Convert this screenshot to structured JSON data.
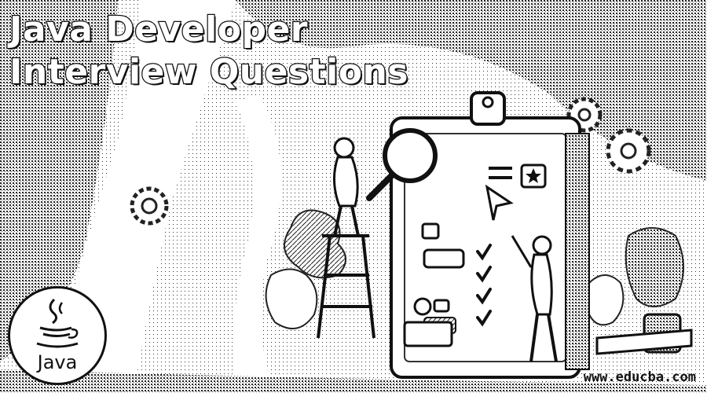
{
  "headline": {
    "line1": "Java Developer",
    "line2": "Interview Questions"
  },
  "badge": {
    "label": "Java",
    "icon": "java-coffee-cup-icon"
  },
  "footer": {
    "url": "www.educba.com"
  },
  "illustration": {
    "icons": [
      "clipboard-icon",
      "magnifier-icon",
      "gear-icon",
      "star-icon",
      "paper-plane-icon",
      "checkmark-icon"
    ]
  },
  "colors": {
    "ink": "#111111",
    "paper": "#ffffff",
    "dither": "#b9b9b9"
  }
}
